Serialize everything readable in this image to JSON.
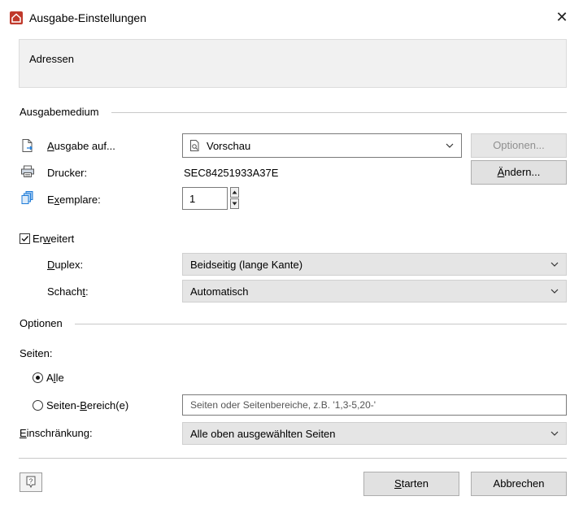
{
  "window": {
    "title": "Ausgabe-Einstellungen",
    "close_glyph": "✕",
    "app_icon": "app-house-icon"
  },
  "header": {
    "text": "Adressen"
  },
  "ausgabemedium": {
    "group_label": "Ausgabemedium",
    "ausgabe_label_pre": "",
    "ausgabe_label_ul": "A",
    "ausgabe_label_post": "usgabe auf...",
    "ausgabe_value": "Vorschau",
    "optionen_button": "Optionen...",
    "drucker_label": "Drucker:",
    "drucker_value": "SEC84251933A37E",
    "aendern_button_ul": "Ä",
    "aendern_button_rest": "ndern...",
    "exemplare_label_pre": "E",
    "exemplare_label_ul": "x",
    "exemplare_label_post": "emplare:",
    "exemplare_value": "1",
    "erweitert_pre": "Er",
    "erweitert_ul": "w",
    "erweitert_post": "eitert",
    "erweitert_checked": true,
    "duplex_label_ul": "D",
    "duplex_label_rest": "uplex:",
    "duplex_value": "Beidseitig (lange Kante)",
    "schacht_label_pre": "Schach",
    "schacht_label_ul": "t",
    "schacht_label_post": ":",
    "schacht_value": "Automatisch"
  },
  "optionen": {
    "group_label": "Optionen",
    "seiten_label": "Seiten:",
    "alle_pre": "A",
    "alle_ul": "l",
    "alle_post": "le",
    "alle_checked": true,
    "bereich_pre": "Seiten-",
    "bereich_ul": "B",
    "bereich_post": "ereich(e)",
    "bereich_placeholder": "Seiten oder Seitenbereiche, z.B. '1,3-5,20-'",
    "einschraenkung_ul": "E",
    "einschraenkung_rest": "inschränkung:",
    "einschraenkung_value": "Alle oben ausgewählten Seiten"
  },
  "footer": {
    "help_icon": "help-icon",
    "starten_ul": "S",
    "starten_rest": "tarten",
    "abbrechen": "Abbrechen"
  },
  "colors": {
    "app_icon": "#c0392b",
    "link_icon": "#1e7bd8"
  }
}
